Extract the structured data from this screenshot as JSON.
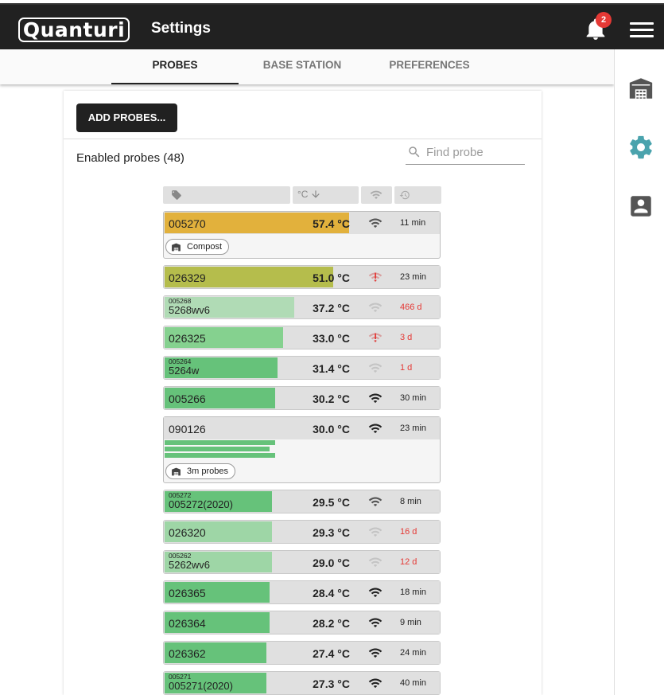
{
  "app": {
    "logo_text": "Quanturi",
    "title": "Settings",
    "notification_count": "2"
  },
  "tabs": [
    {
      "label": "PROBES",
      "active": true
    },
    {
      "label": "BASE STATION",
      "active": false
    },
    {
      "label": "PREFERENCES",
      "active": false
    }
  ],
  "sidebar": {
    "items": [
      "warehouse-icon",
      "gear-icon",
      "account-box-icon"
    ],
    "active_color": "#4aa3ad"
  },
  "card": {
    "add_button": "ADD PROBES...",
    "enabled_label": "Enabled probes (48)",
    "search_placeholder": "Find probe",
    "header": {
      "temp_label": "°C",
      "sort": "descending"
    }
  },
  "probes": [
    {
      "id": "005270",
      "temp": "57.4 °C",
      "age": "11 min",
      "age_stale": false,
      "signal": "good-grey",
      "fill_pct": 67,
      "color": "#e2b13c",
      "tag": "Compost"
    },
    {
      "id": "026329",
      "temp": "51.0 °C",
      "age": "23 min",
      "age_stale": false,
      "signal": "alert",
      "fill_pct": 61,
      "color": "#b5bd4c"
    },
    {
      "id": "5268wv6",
      "sub": "005268",
      "temp": "37.2 °C",
      "age": "466 d",
      "age_stale": true,
      "signal": "faded",
      "fill_pct": 47,
      "color": "#b0dbb5"
    },
    {
      "id": "026325",
      "temp": "33.0 °C",
      "age": "3 d",
      "age_stale": true,
      "signal": "alert",
      "fill_pct": 43,
      "color": "#85d18f"
    },
    {
      "id": "5264w",
      "sub": "005264",
      "temp": "31.4 °C",
      "age": "1 d",
      "age_stale": true,
      "signal": "faded",
      "fill_pct": 41,
      "color": "#66c27a"
    },
    {
      "id": "005266",
      "temp": "30.2 °C",
      "age": "30 min",
      "age_stale": false,
      "signal": "good",
      "fill_pct": 40,
      "color": "#66c27a"
    },
    {
      "id": "090126",
      "temp": "30.0 °C",
      "age": "23 min",
      "age_stale": false,
      "signal": "good",
      "fill_pct": 0,
      "color": "#66c27a",
      "tag": "3m probes",
      "multi_levels": [
        40,
        38,
        40
      ]
    },
    {
      "id": "005272(2020)",
      "sub": "005272",
      "temp": "29.5 °C",
      "age": "8 min",
      "age_stale": false,
      "signal": "good-grey",
      "fill_pct": 39,
      "color": "#66c27a"
    },
    {
      "id": "026320",
      "temp": "29.3 °C",
      "age": "16 d",
      "age_stale": true,
      "signal": "faded",
      "fill_pct": 39,
      "color": "#9ed6a6"
    },
    {
      "id": "5262wv6",
      "sub": "005262",
      "temp": "29.0 °C",
      "age": "12 d",
      "age_stale": true,
      "signal": "faded",
      "fill_pct": 39,
      "color": "#9ed6a6"
    },
    {
      "id": "026365",
      "temp": "28.4 °C",
      "age": "18 min",
      "age_stale": false,
      "signal": "full",
      "fill_pct": 38,
      "color": "#66c27a"
    },
    {
      "id": "026364",
      "temp": "28.2 °C",
      "age": "9 min",
      "age_stale": false,
      "signal": "full",
      "fill_pct": 38,
      "color": "#66c27a"
    },
    {
      "id": "026362",
      "temp": "27.4 °C",
      "age": "24 min",
      "age_stale": false,
      "signal": "full",
      "fill_pct": 37,
      "color": "#66c27a"
    },
    {
      "id": "005271(2020)",
      "sub": "005271",
      "temp": "27.3 °C",
      "age": "40 min",
      "age_stale": false,
      "signal": "full",
      "fill_pct": 37,
      "color": "#66c27a"
    }
  ]
}
